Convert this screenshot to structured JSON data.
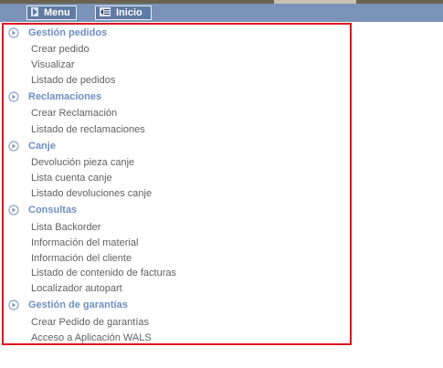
{
  "nav": {
    "menu_label": "Menu",
    "inicio_label": "Inicio"
  },
  "sections": [
    {
      "title": "Gestión pedidos",
      "items": [
        "Crear pedido",
        "Visualizar",
        "Listado de pedidos"
      ]
    },
    {
      "title": "Reclamaciones",
      "items": [
        "Crear Reclamación",
        "Listado de reclamaciones"
      ]
    },
    {
      "title": "Canje",
      "items": [
        "Devolución pieza canje",
        "Lista cuenta canje",
        "Listado devoluciones canje"
      ]
    },
    {
      "title": "Consultas",
      "items": [
        "Lista Backorder",
        "Información del material",
        "Información del cliente",
        "Listado de contenido de facturas",
        "Localizador autopart"
      ]
    },
    {
      "title": "Gestión de garantías",
      "items": [
        "Crear Pedido de garantías",
        "Acceso a Aplicación WALS"
      ]
    }
  ],
  "colors": {
    "accent_section": "#6d8fc2",
    "item_text": "#616161",
    "panel_border": "#e0141e",
    "navbar": "#7b93b8"
  }
}
